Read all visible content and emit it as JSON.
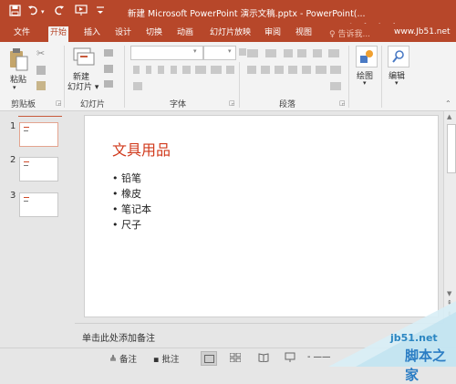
{
  "titlebar": {
    "title": "新建 Microsoft PowerPoint 演示文稿.pptx - PowerPoint(...",
    "save_icon": "save-icon",
    "undo_icon": "undo-icon",
    "redo_icon": "repeat-icon",
    "slideshow_icon": "present-icon",
    "customize_icon": "customize-icon"
  },
  "tabs": [
    "文件",
    "开始",
    "插入",
    "设计",
    "切换",
    "动画",
    "幻灯片放映",
    "审阅",
    "视图"
  ],
  "active_tab": "开始",
  "tell_me": "♀ 告诉我...",
  "ribbon": {
    "paste_label": "粘贴",
    "new_slide_label_1": "新建",
    "new_slide_label_2": "幻灯片 ▾",
    "drawing_label": "绘图",
    "drawing_arrow": "▾",
    "editing_label": "编辑",
    "editing_arrow": "▾",
    "groups": [
      "剪贴板",
      "幻灯片",
      "字体",
      "段落"
    ]
  },
  "thumbnails": [
    {
      "number": "1",
      "selected": true
    },
    {
      "number": "2",
      "selected": false
    },
    {
      "number": "3",
      "selected": false
    }
  ],
  "slide": {
    "title": "文具用品",
    "bullets": [
      "• 铅笔",
      "• 橡皮",
      "• 笔记本",
      "• 尺子"
    ]
  },
  "notes_placeholder": "单击此处添加备注",
  "status": {
    "notes_label": "≜ 备注",
    "comments_label": "▪ 批注",
    "zoom_minus": "- ——"
  },
  "watermark": {
    "top_text": "脚本之家",
    "top_url": "www.Jb51.net",
    "bottom_url": "jb51.net",
    "bottom_text": "脚本之家"
  },
  "colors": {
    "accent": "#b7472a",
    "title_red": "#d0391b"
  }
}
